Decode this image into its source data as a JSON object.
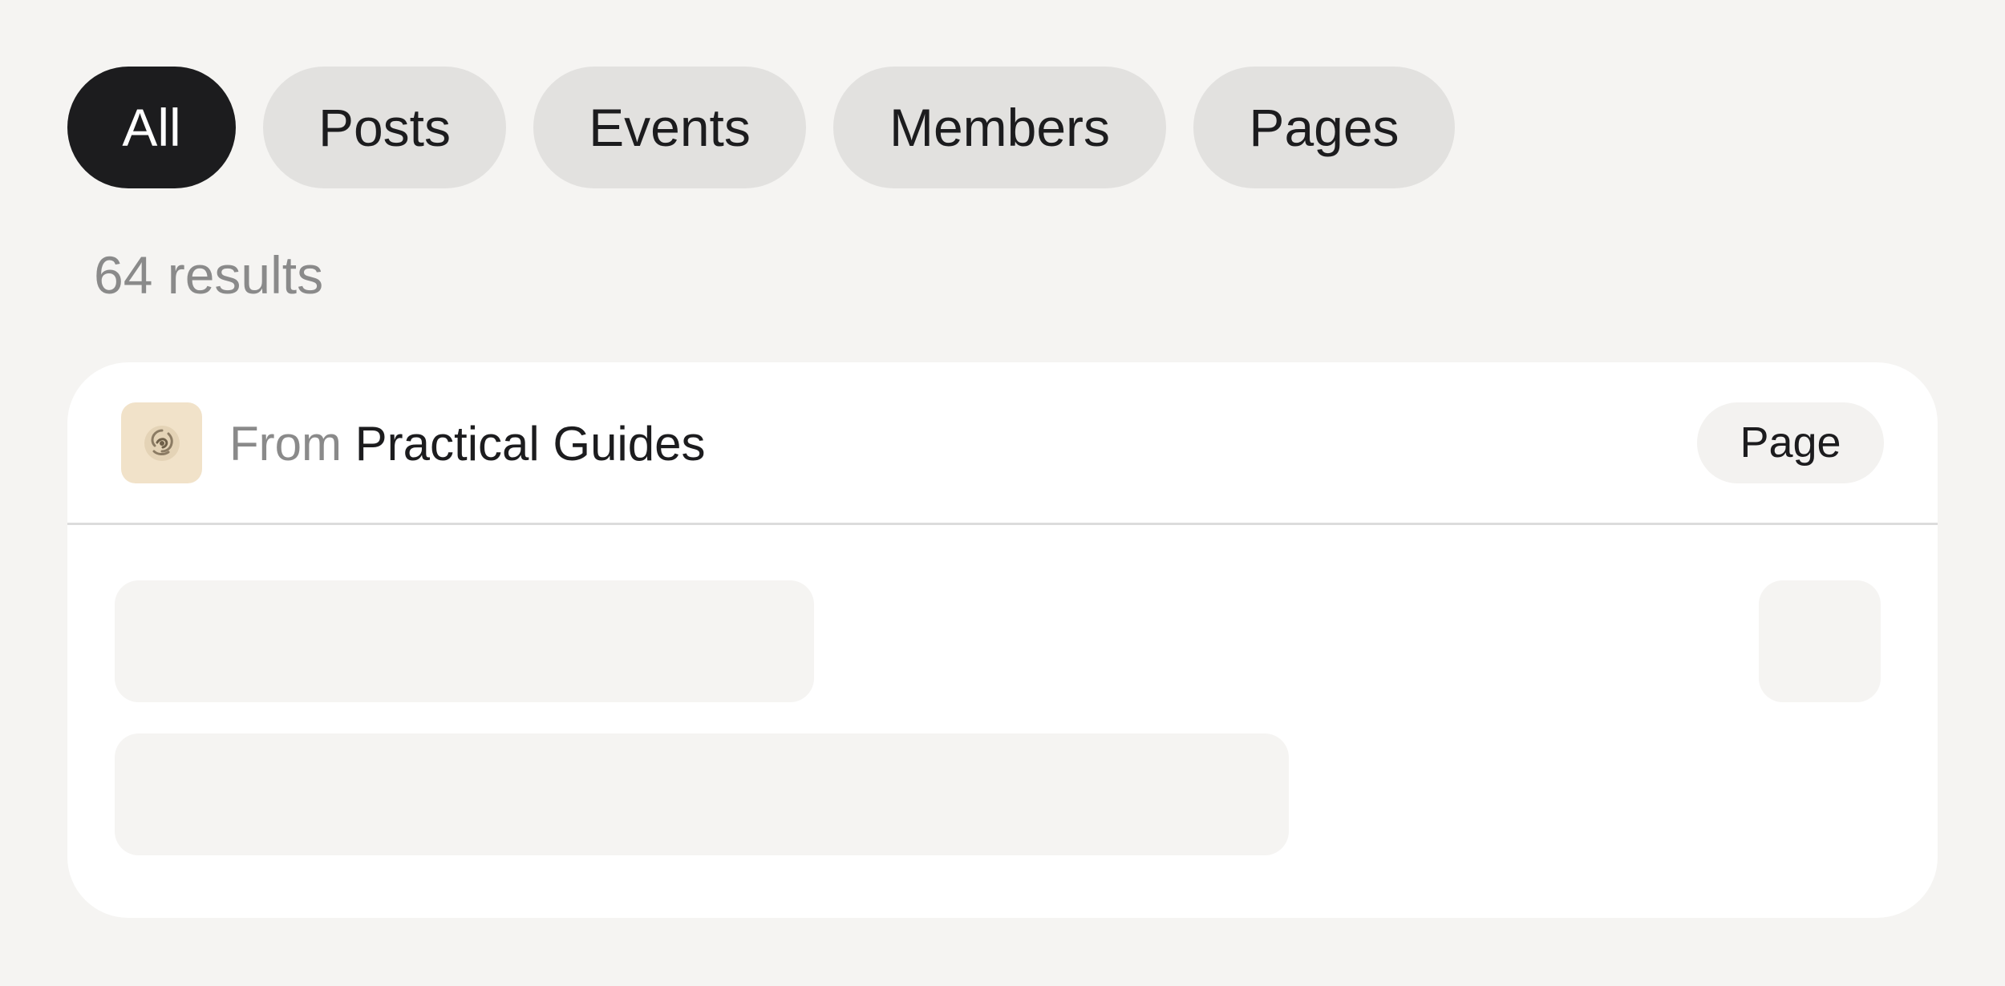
{
  "filters": {
    "tabs": [
      {
        "label": "All",
        "active": true
      },
      {
        "label": "Posts",
        "active": false
      },
      {
        "label": "Events",
        "active": false
      },
      {
        "label": "Members",
        "active": false
      },
      {
        "label": "Pages",
        "active": false
      }
    ]
  },
  "results": {
    "count_text": "64 results"
  },
  "result_card": {
    "source_prefix": "From",
    "source_name": "Practical Guides",
    "source_icon": "rose-icon",
    "type_badge": "Page",
    "loading": true
  },
  "colors": {
    "active_tab_bg": "#1c1c1e",
    "inactive_tab_bg": "#e2e1df",
    "page_bg": "#f5f4f2",
    "card_bg": "#ffffff",
    "muted_text": "#8a8a8a",
    "avatar_bg": "#f1e2c9"
  }
}
